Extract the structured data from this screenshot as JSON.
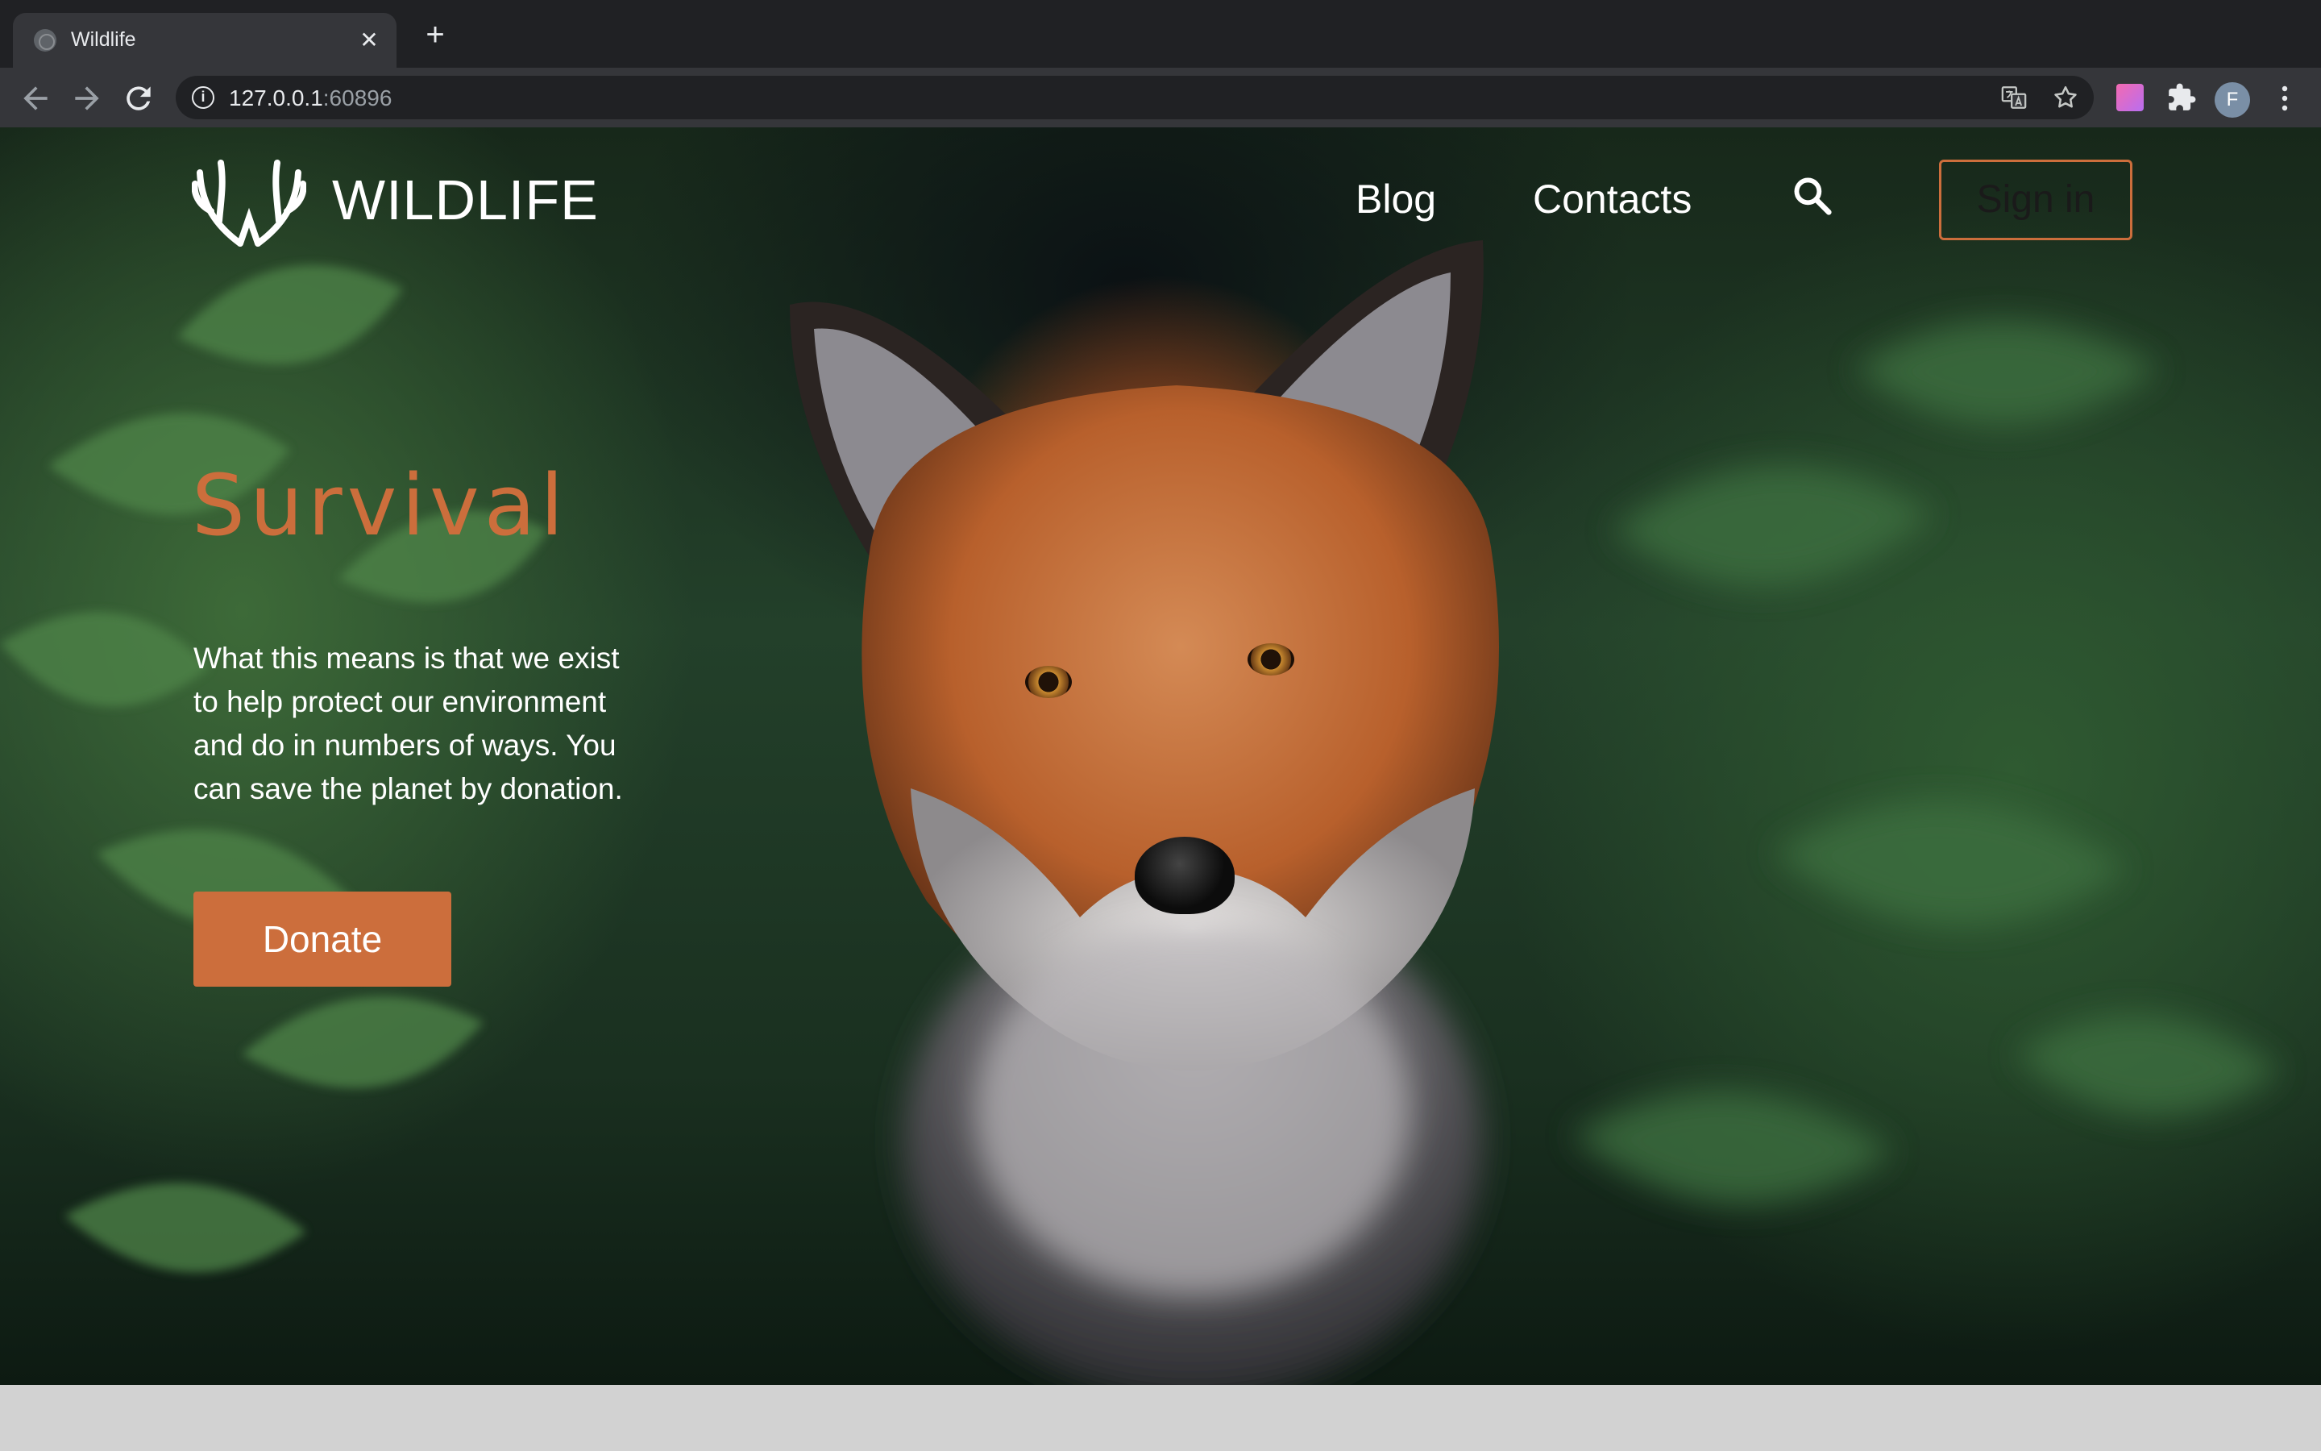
{
  "browser": {
    "tab_title": "Wildlife",
    "tab_close": "✕",
    "new_tab": "+",
    "url_host": "127.0.0.1",
    "url_port": ":60896",
    "profile_initial": "F"
  },
  "site": {
    "name": "WILDLIFE",
    "nav": {
      "blog": "Blog",
      "contacts": "Contacts"
    },
    "signin_label": "Sign in",
    "hero": {
      "title": "Survival",
      "text": "What this means is that we exist to help protect our environment and do in numbers of ways. You can save the planet by donation.",
      "donate_label": "Donate"
    }
  },
  "colors": {
    "accent": "#cc6e3c",
    "chrome_dark": "#202124",
    "chrome_toolbar": "#35363a",
    "footer_band": "#d2d2d2"
  }
}
